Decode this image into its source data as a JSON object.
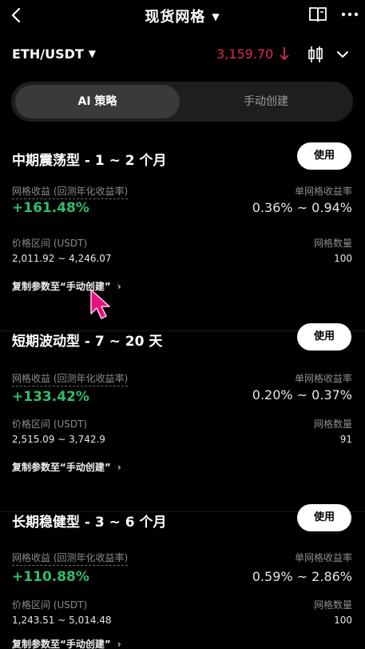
{
  "header": {
    "title": "现货网格",
    "title_caret": "▼"
  },
  "pair": {
    "name": "ETH/USDT",
    "caret": "▼",
    "price": "3,159.70",
    "price_color": "#e0295a"
  },
  "tabs": [
    {
      "label": "AI 策略",
      "active": true
    },
    {
      "label": "手动创建",
      "active": false
    }
  ],
  "colors": {
    "positive": "#2fbd6e",
    "negative": "#e0295a",
    "background": "#000000",
    "tab_bg": "#1e1e1e"
  },
  "strategies": [
    {
      "title": "中期震荡型 - 1 ~ 2 个月",
      "use_label": "使用",
      "grid_profit_label": "网格收益 (回测年化收益率)",
      "grid_profit": "+161.48%",
      "per_grid_label": "单网格收益率",
      "per_grid": "0.36% ~ 0.94%",
      "range_label": "价格区间 (USDT)",
      "range": "2,011.92 ~ 4,246.07",
      "count_label": "网格数量",
      "count": "100",
      "copy_label": "复制参数至“手动创建”",
      "copy_chevron": "›"
    },
    {
      "title": "短期波动型 - 7 ~ 20 天",
      "use_label": "使用",
      "grid_profit_label": "网格收益 (回测年化收益率)",
      "grid_profit": "+133.42%",
      "per_grid_label": "单网格收益率",
      "per_grid": "0.20% ~ 0.37%",
      "range_label": "价格区间 (USDT)",
      "range": "2,515.09 ~ 3,742.9",
      "count_label": "网格数量",
      "count": "91",
      "copy_label": "复制参数至“手动创建”",
      "copy_chevron": "›"
    },
    {
      "title": "长期稳健型 - 3 ~ 6 个月",
      "use_label": "使用",
      "grid_profit_label": "网格收益 (回测年化收益率)",
      "grid_profit": "+110.88%",
      "per_grid_label": "单网格收益率",
      "per_grid": "0.59% ~ 2.86%",
      "range_label": "价格区间 (USDT)",
      "range": "1,243.51 ~ 5,014.48",
      "count_label": "网格数量",
      "count": "100",
      "copy_label": "复制参数至“手动创建”",
      "copy_chevron": "›"
    }
  ],
  "icons": {
    "back": "back-icon",
    "book": "book-icon",
    "more": "more-icon",
    "price_direction": "arrow-down-icon",
    "candles": "candlestick-icon",
    "expand": "chevron-down-icon",
    "pointer": "cursor-icon"
  }
}
